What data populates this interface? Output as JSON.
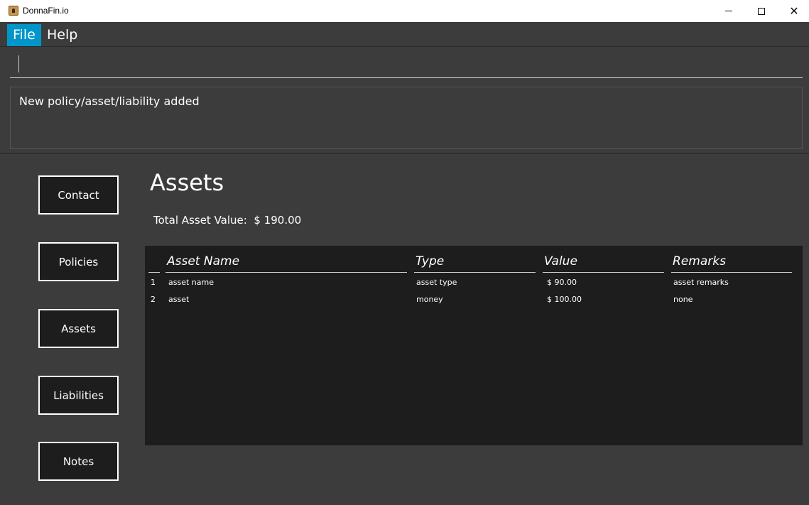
{
  "window": {
    "title": "DonnaFin.io",
    "minimize_glyph": "—",
    "maximize_glyph": "☐",
    "close_glyph": "✕"
  },
  "menu": {
    "items": [
      {
        "label": "File"
      },
      {
        "label": "Help"
      }
    ]
  },
  "command": {
    "value": "",
    "placeholder": ""
  },
  "result": {
    "message": "New policy/asset/liability added"
  },
  "sidebar": {
    "buttons": [
      {
        "label": "Contact"
      },
      {
        "label": "Policies"
      },
      {
        "label": "Assets"
      },
      {
        "label": "Liabilities"
      },
      {
        "label": "Notes"
      }
    ]
  },
  "main": {
    "title": "Assets",
    "total_label": "Total Asset Value:",
    "total_value": "$ 190.00",
    "table": {
      "columns": [
        "Asset Name",
        "Type",
        "Value",
        "Remarks"
      ],
      "rows": [
        {
          "index": "1",
          "name": "asset name",
          "type": "asset type",
          "value": "$ 90.00",
          "remarks": "asset remarks"
        },
        {
          "index": "2",
          "name": "asset",
          "type": "money",
          "value": "$ 100.00",
          "remarks": "none"
        }
      ]
    }
  },
  "colors": {
    "background": "#3c3c3c",
    "panel": "#1d1d1d",
    "accent": "#0096c9",
    "text": "#ffffff"
  }
}
